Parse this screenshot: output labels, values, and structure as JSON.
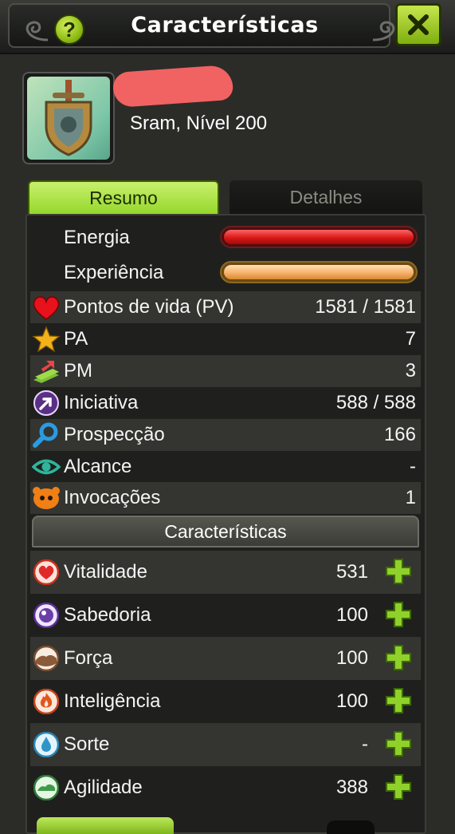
{
  "window": {
    "title": "Características",
    "help_icon": "question-mark",
    "close_icon": "close-x"
  },
  "character": {
    "class_level": "Sram, Nível 200",
    "portrait_icon": "shield-sword-emblem"
  },
  "tabs": [
    {
      "label": "Resumo",
      "active": true
    },
    {
      "label": "Detalhes",
      "active": false
    }
  ],
  "bars": {
    "energy": {
      "label": "Energia",
      "fill": 1.0,
      "color": "#d81818"
    },
    "experience": {
      "label": "Experiência",
      "fill": 1.0,
      "color": "#f6b26b"
    }
  },
  "stats": [
    {
      "icon": "heart",
      "label": "Pontos de vida (PV)",
      "value": "1581 / 1581"
    },
    {
      "icon": "star",
      "label": "PA",
      "value": "7"
    },
    {
      "icon": "movement-arrow",
      "label": "PM",
      "value": "3"
    },
    {
      "icon": "initiative-arrow",
      "label": "Iniciativa",
      "value": "588 / 588"
    },
    {
      "icon": "magnifier",
      "label": "Prospecção",
      "value": "166"
    },
    {
      "icon": "eye",
      "label": "Alcance",
      "value": "-"
    },
    {
      "icon": "summon-creature",
      "label": "Invocações",
      "value": "1"
    }
  ],
  "characteristics_header": "Características",
  "characteristics": [
    {
      "icon": "vitality-heart",
      "label": "Vitalidade",
      "value": "531",
      "color": "#e23030"
    },
    {
      "icon": "wisdom-orb",
      "label": "Sabedoria",
      "value": "100",
      "color": "#6b3fa8"
    },
    {
      "icon": "strength-earth",
      "label": "Força",
      "value": "100",
      "color": "#8a5a3a"
    },
    {
      "icon": "intelligence-fire",
      "label": "Inteligência",
      "value": "100",
      "color": "#e0561f"
    },
    {
      "icon": "chance-water",
      "label": "Sorte",
      "value": "-",
      "color": "#2f95c7"
    },
    {
      "icon": "agility-air",
      "label": "Agilidade",
      "value": "388",
      "color": "#3f9b4a"
    }
  ],
  "colors": {
    "accent_green": "#95d72b",
    "panel_bg": "#1f201e",
    "row_alt": "#343531"
  }
}
